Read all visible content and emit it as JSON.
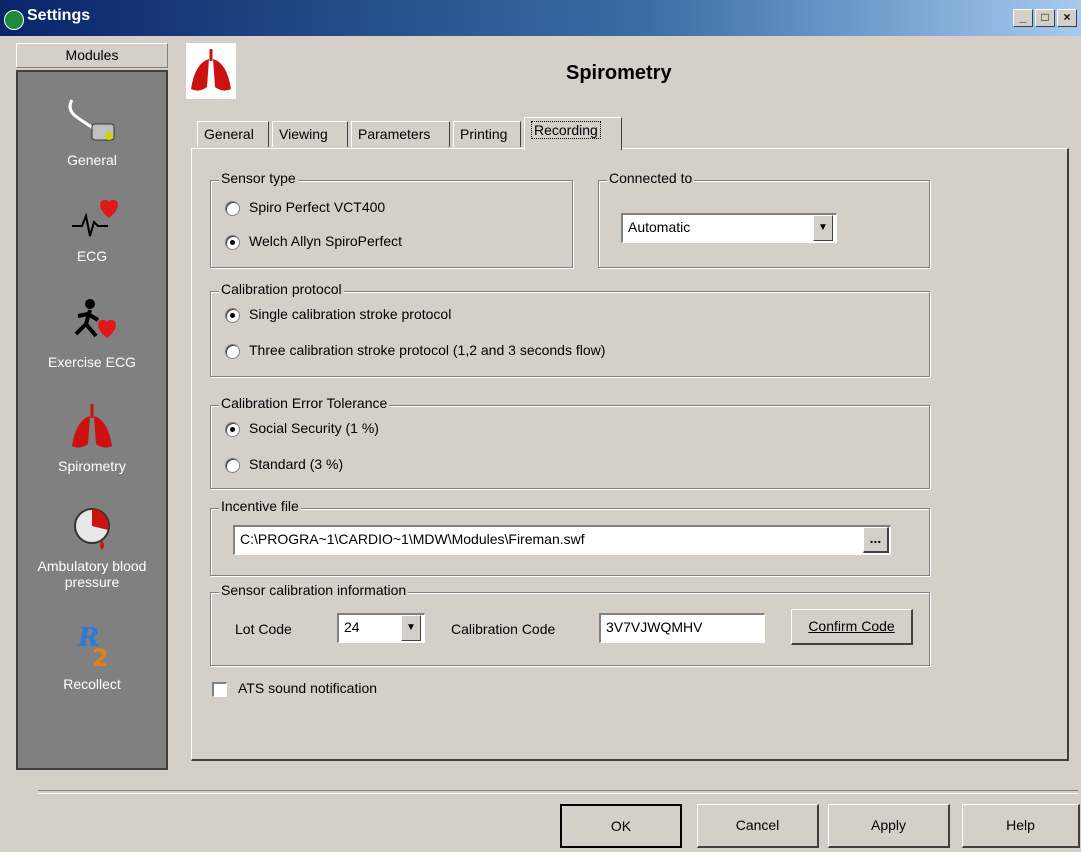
{
  "window": {
    "title": "Settings",
    "minimize_label": "_",
    "maximize_label": "□",
    "close_label": "×"
  },
  "modules": {
    "header": "Modules",
    "items": [
      {
        "label": "General",
        "icon": "phone-settings-icon"
      },
      {
        "label": "ECG",
        "icon": "ecg-heart-icon"
      },
      {
        "label": "Exercise ECG",
        "icon": "runner-heart-icon"
      },
      {
        "label": "Spirometry",
        "icon": "lungs-icon"
      },
      {
        "label": "Ambulatory blood pressure",
        "icon": "blood-pressure-icon"
      },
      {
        "label": "Recollect",
        "icon": "recollect-icon"
      }
    ]
  },
  "page": {
    "title": "Spirometry"
  },
  "tabs": [
    "General",
    "Viewing",
    "Parameters",
    "Printing",
    "Recording"
  ],
  "active_tab": "Recording",
  "sensor_type": {
    "legend": "Sensor type",
    "options": [
      "Spiro Perfect VCT400",
      "Welch Allyn SpiroPerfect"
    ],
    "selected": "Welch Allyn SpiroPerfect"
  },
  "connected_to": {
    "legend": "Connected to",
    "value": "Automatic"
  },
  "calibration_protocol": {
    "legend": "Calibration protocol",
    "options": [
      "Single calibration stroke protocol",
      "Three calibration stroke protocol (1,2 and 3 seconds flow)"
    ],
    "selected": "Single calibration stroke protocol"
  },
  "error_tolerance": {
    "legend": "Calibration Error Tolerance",
    "options": [
      "Social Security (1 %)",
      "Standard (3 %)"
    ],
    "selected": "Social Security (1 %)"
  },
  "incentive_file": {
    "legend": "Incentive file",
    "value": "C:\\PROGRA~1\\CARDIO~1\\MDW\\Modules\\Fireman.swf",
    "browse_label": "..."
  },
  "sensor_calibration": {
    "legend": "Sensor calibration information",
    "lot_code_label": "Lot Code",
    "lot_code_value": "24",
    "calibration_code_label": "Calibration Code",
    "calibration_code_value": "3V7VJWQMHV",
    "confirm_label": "Confirm Code"
  },
  "ats": {
    "label": "ATS sound notification",
    "checked": false
  },
  "footer": {
    "ok": "OK",
    "cancel": "Cancel",
    "apply": "Apply",
    "help": "Help"
  },
  "colors": {
    "titlebar": "#0a246a",
    "sidebar": "#808080",
    "face": "#d4d0c8",
    "lung_red": "#cc1111"
  }
}
